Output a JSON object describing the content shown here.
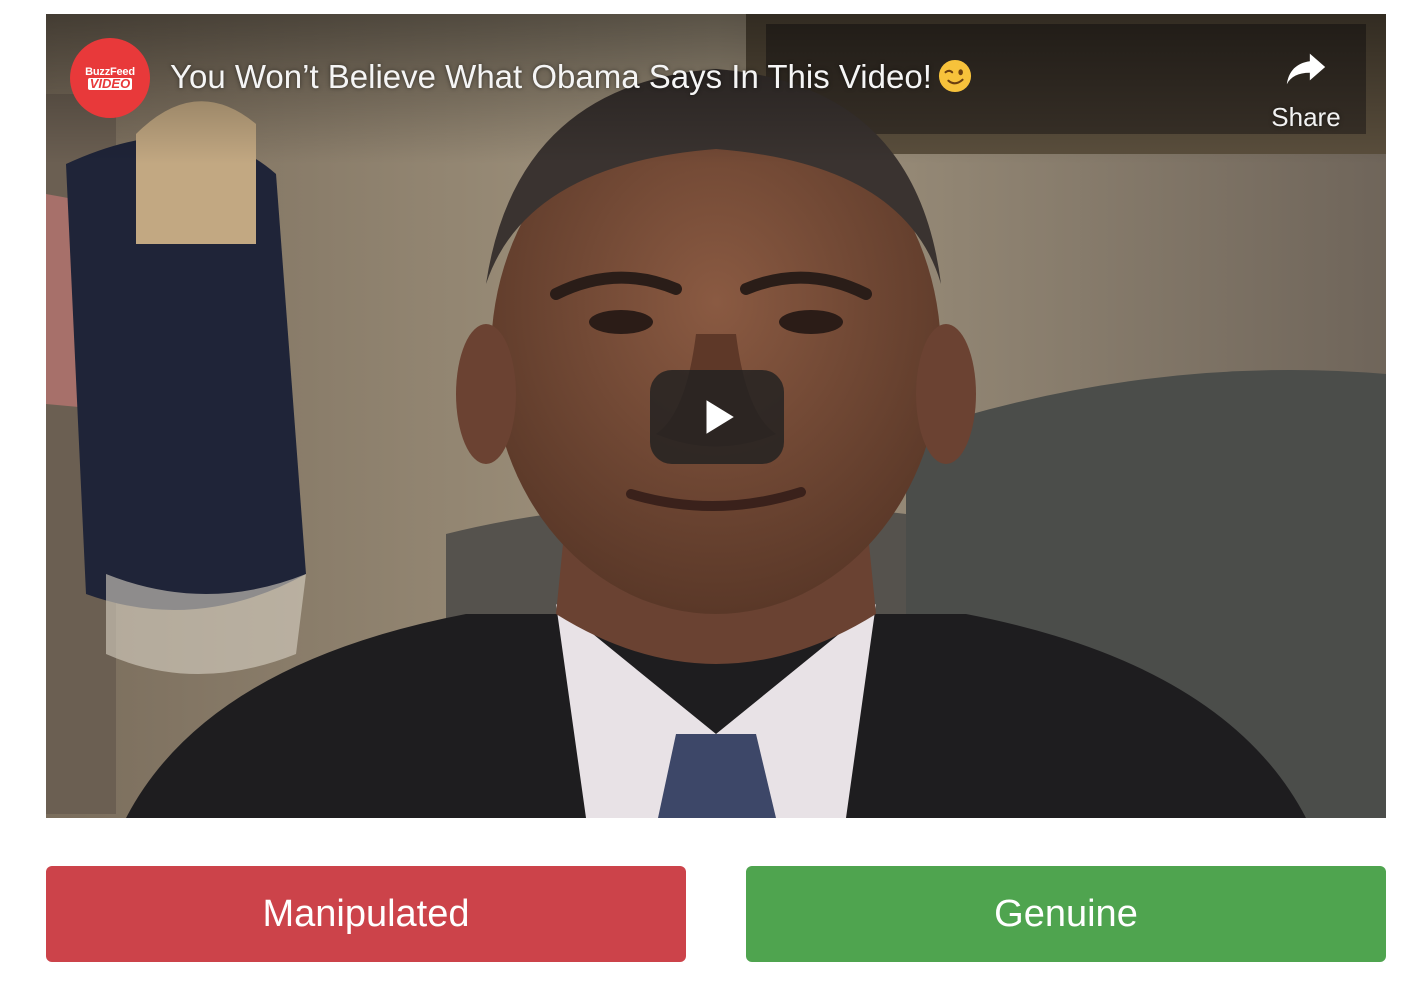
{
  "video": {
    "channel_logo": {
      "line1": "BuzzFeed",
      "line2": "VIDEO",
      "color": "#e8393a"
    },
    "title": "You Won’t Believe What Obama Says In This Video!",
    "title_emoji": "winking-face-icon",
    "share_label": "Share",
    "share_icon": "share-arrow-icon",
    "play_icon": "play-icon"
  },
  "answers": {
    "manipulated": {
      "label": "Manipulated",
      "color": "#cc434a"
    },
    "genuine": {
      "label": "Genuine",
      "color": "#4fa44f"
    }
  }
}
